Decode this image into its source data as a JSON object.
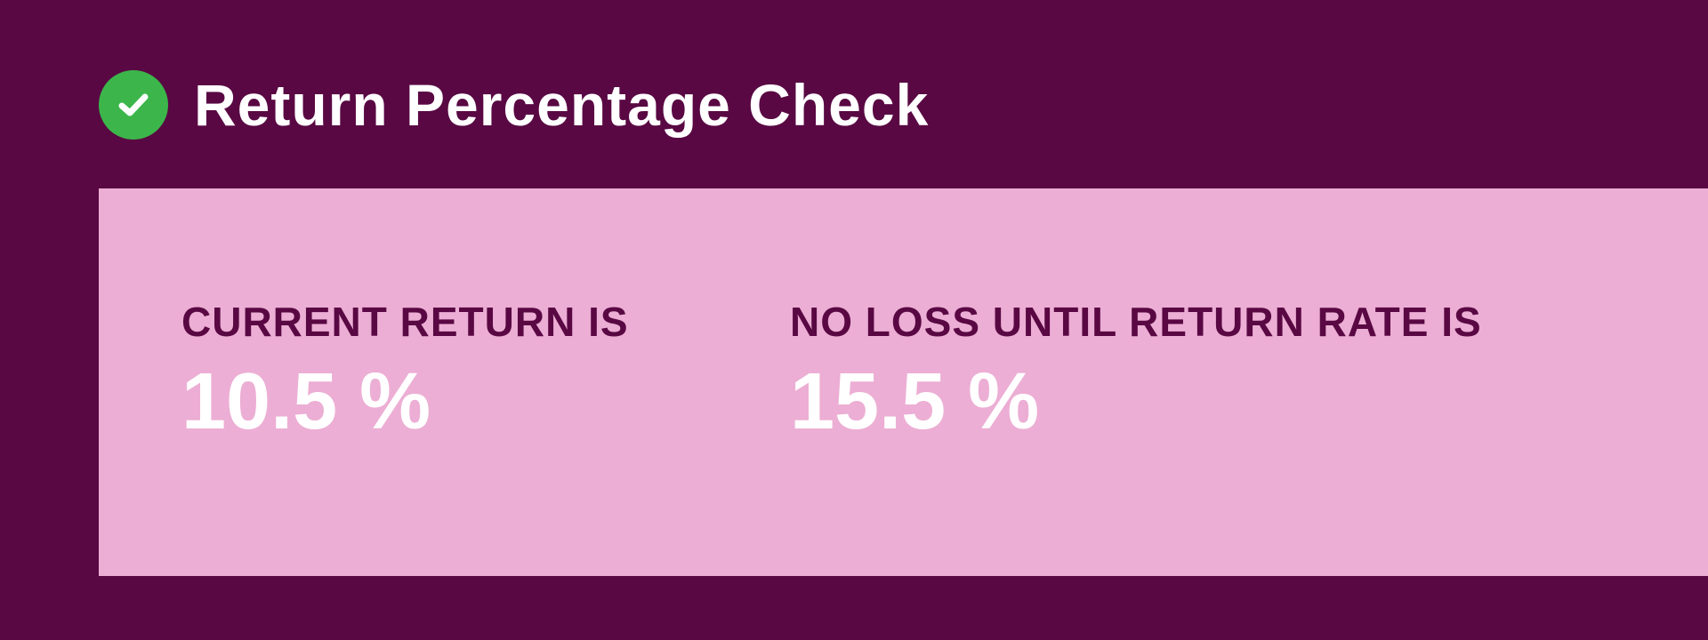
{
  "header": {
    "title": "Return Percentage Check",
    "icon": "check-circle-icon",
    "icon_color": "#3cb64b"
  },
  "metrics": {
    "current_return": {
      "label": "CURRENT RETURN IS",
      "value": "10.5 %"
    },
    "break_even": {
      "label": "NO LOSS UNTIL RETURN RATE IS",
      "value": "15.5 %"
    }
  },
  "colors": {
    "background": "#590843",
    "panel": "#ecaed4",
    "label_text": "#590843",
    "value_text": "#ffffff",
    "title_text": "#ffffff"
  }
}
